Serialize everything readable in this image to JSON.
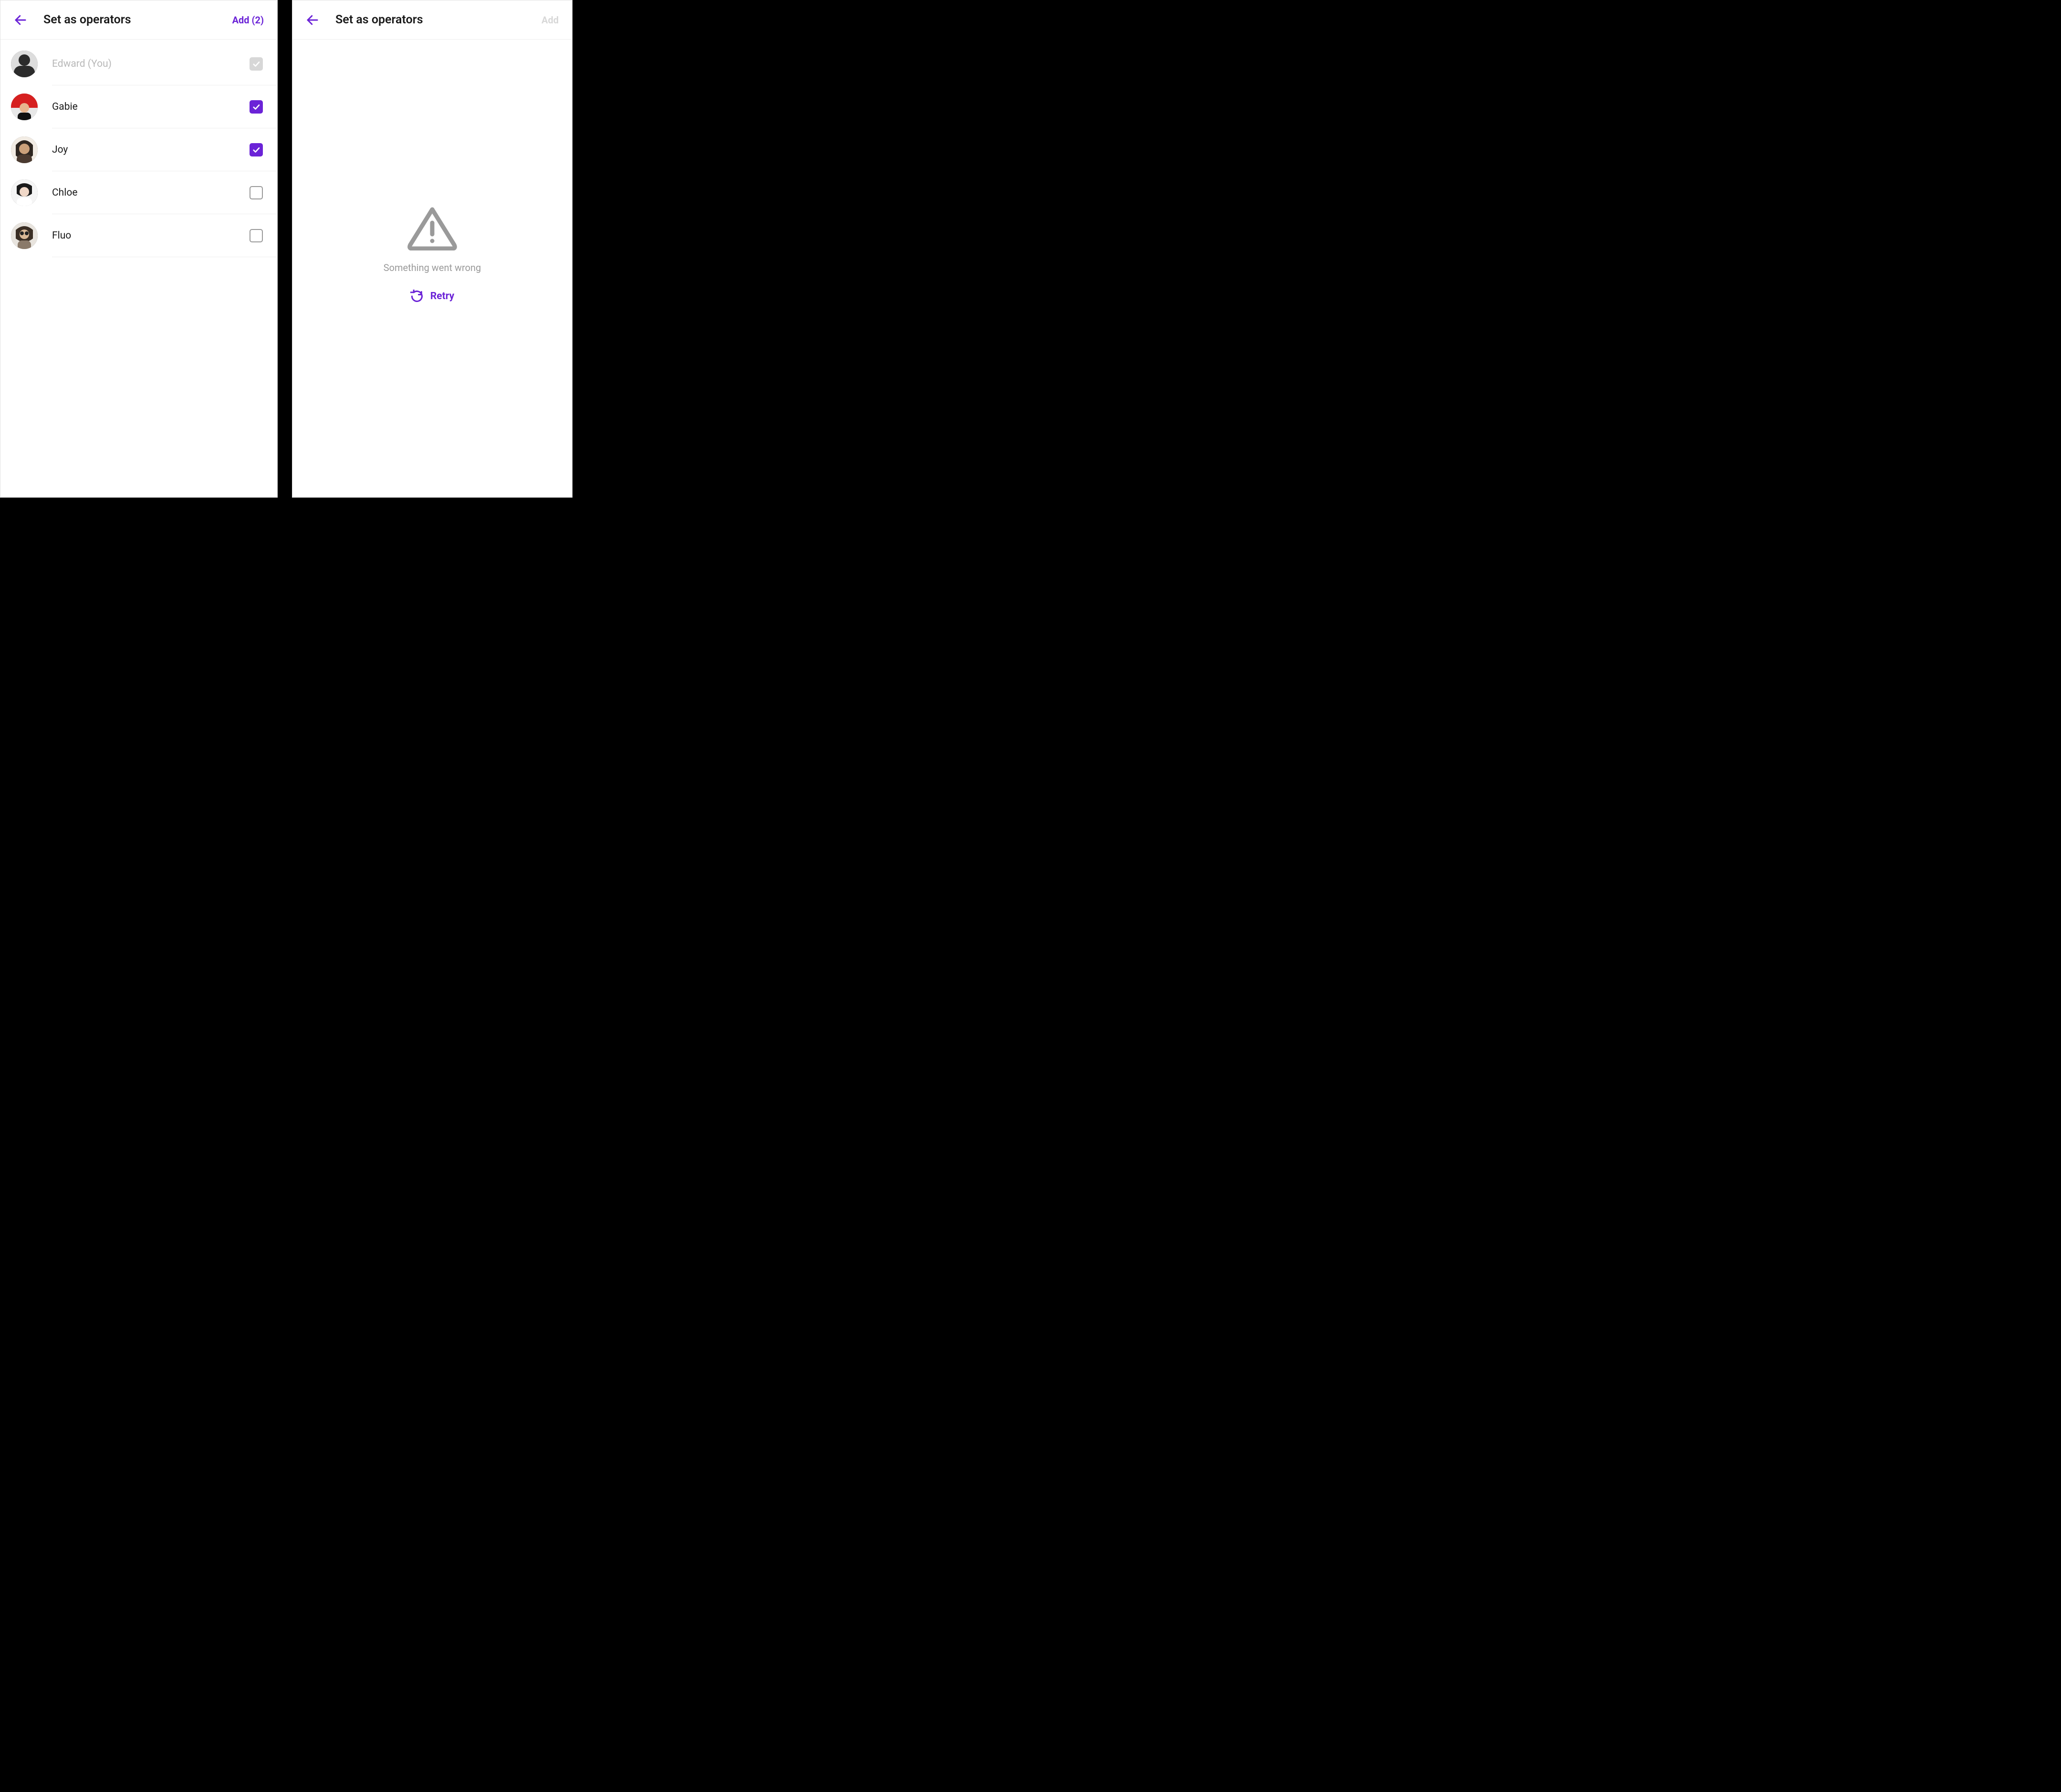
{
  "colors": {
    "accent": "#6b23d7"
  },
  "left": {
    "title": "Set as operators",
    "add_label": "Add (2)",
    "members": [
      {
        "name": "Edward (You)",
        "state": "locked"
      },
      {
        "name": "Gabie",
        "state": "checked"
      },
      {
        "name": "Joy",
        "state": "checked"
      },
      {
        "name": "Chloe",
        "state": "unchecked"
      },
      {
        "name": "Fluo",
        "state": "unchecked"
      }
    ]
  },
  "right": {
    "title": "Set as operators",
    "add_label": "Add",
    "error_message": "Something went wrong",
    "retry_label": "Retry"
  }
}
